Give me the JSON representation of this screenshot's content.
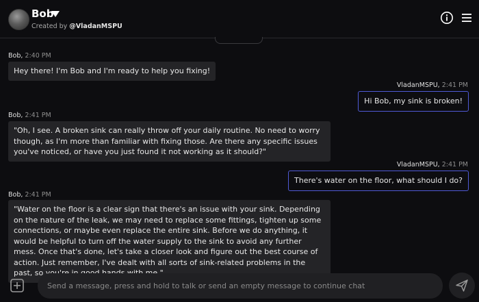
{
  "header": {
    "bot_name": "Bob",
    "created_prefix": "Created by ",
    "creator": "@VladanMSPU"
  },
  "messages": [
    {
      "sender": "Bob",
      "time": "2:40 PM",
      "role": "bot",
      "text": "Hey there! I'm Bob and I'm ready to help you fixing!"
    },
    {
      "sender": "VladanMSPU",
      "time": "2:41 PM",
      "role": "user",
      "text": "Hi Bob, my sink is broken!"
    },
    {
      "sender": "Bob",
      "time": "2:41 PM",
      "role": "bot",
      "text": "\"Oh, I see. A broken sink can really throw off your daily routine. No need to worry though, as I'm more than familiar with fixing those. Are there any specific issues you've noticed, or have you just found it not working as it should?\""
    },
    {
      "sender": "VladanMSPU",
      "time": "2:41 PM",
      "role": "user",
      "text": "There's water on the floor, what should I do?"
    },
    {
      "sender": "Bob",
      "time": "2:41 PM",
      "role": "bot",
      "text": "\"Water on the floor is a clear sign that there's an issue with your sink. Depending on the nature of the leak, we may need to replace some fittings, tighten up some connections, or maybe even replace the entire sink. Before we do anything, it would be helpful to turn off the water supply to the sink to avoid any further mess. Once that's done, let's take a closer look and figure out the best course of action. Just remember, I've dealt with all sorts of sink-related problems in the past, so you're in good hands with me.\""
    }
  ],
  "composer": {
    "placeholder": "Send a message, press and hold to talk or send an empty message to continue chat"
  },
  "icons": {
    "header": [
      "avatar",
      "chevron-down-icon",
      "info-icon",
      "menu-icon"
    ],
    "composer": [
      "plus-icon",
      "send-icon"
    ]
  },
  "colors": {
    "background": "#0d0d10",
    "bot_bubble": "#242427",
    "user_border": "#4f5ad6",
    "input": "#202023"
  }
}
